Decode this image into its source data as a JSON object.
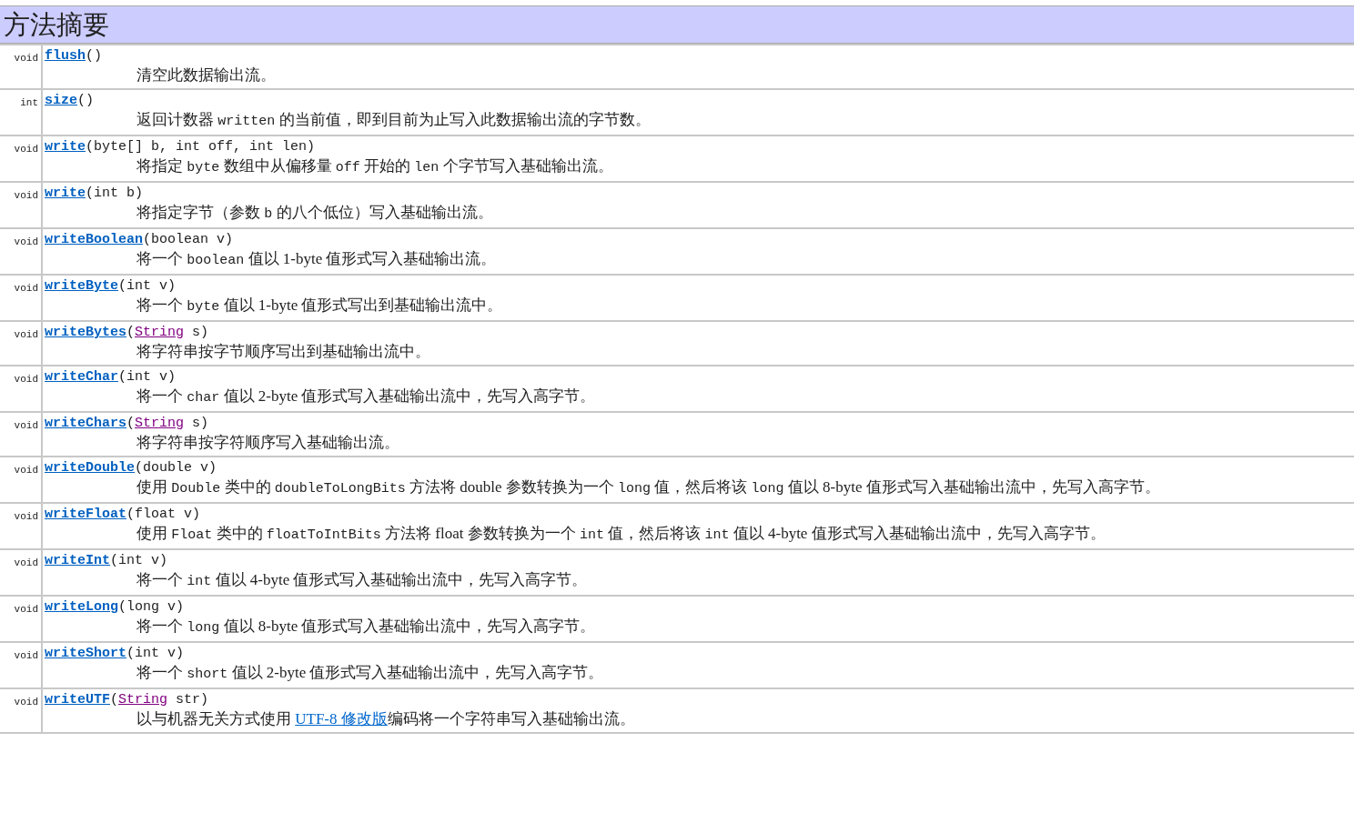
{
  "title": "方法摘要",
  "methods": [
    {
      "type": "void",
      "name": "flush",
      "params": [
        {
          "kind": "text",
          "text": "()"
        }
      ],
      "description": [
        {
          "kind": "text",
          "text": "清空此数据输出流。"
        }
      ]
    },
    {
      "type": "int",
      "name": "size",
      "params": [
        {
          "kind": "text",
          "text": "()"
        }
      ],
      "description": [
        {
          "kind": "text",
          "text": "返回计数器 "
        },
        {
          "kind": "code",
          "text": "written"
        },
        {
          "kind": "text",
          "text": " 的当前值，即到目前为止写入此数据输出流的字节数。"
        }
      ]
    },
    {
      "type": "void",
      "name": "write",
      "params": [
        {
          "kind": "text",
          "text": "(byte[] b, int off, int len)"
        }
      ],
      "description": [
        {
          "kind": "text",
          "text": "将指定 "
        },
        {
          "kind": "code",
          "text": "byte"
        },
        {
          "kind": "text",
          "text": " 数组中从偏移量 "
        },
        {
          "kind": "code",
          "text": "off"
        },
        {
          "kind": "text",
          "text": " 开始的 "
        },
        {
          "kind": "code",
          "text": "len"
        },
        {
          "kind": "text",
          "text": " 个字节写入基础输出流。"
        }
      ]
    },
    {
      "type": "void",
      "name": "write",
      "params": [
        {
          "kind": "text",
          "text": "(int b)"
        }
      ],
      "description": [
        {
          "kind": "text",
          "text": "将指定字节（参数 "
        },
        {
          "kind": "code",
          "text": "b"
        },
        {
          "kind": "text",
          "text": " 的八个低位）写入基础输出流。"
        }
      ]
    },
    {
      "type": "void",
      "name": "writeBoolean",
      "params": [
        {
          "kind": "text",
          "text": "(boolean v)"
        }
      ],
      "description": [
        {
          "kind": "text",
          "text": "将一个 "
        },
        {
          "kind": "code",
          "text": "boolean"
        },
        {
          "kind": "text",
          "text": " 值以 1-byte 值形式写入基础输出流。"
        }
      ]
    },
    {
      "type": "void",
      "name": "writeByte",
      "params": [
        {
          "kind": "text",
          "text": "(int v)"
        }
      ],
      "description": [
        {
          "kind": "text",
          "text": "将一个 "
        },
        {
          "kind": "code",
          "text": "byte"
        },
        {
          "kind": "text",
          "text": " 值以 1-byte 值形式写出到基础输出流中。"
        }
      ]
    },
    {
      "type": "void",
      "name": "writeBytes",
      "params": [
        {
          "kind": "text",
          "text": "("
        },
        {
          "kind": "link",
          "text": "String"
        },
        {
          "kind": "text",
          "text": " s)"
        }
      ],
      "description": [
        {
          "kind": "text",
          "text": "将字符串按字节顺序写出到基础输出流中。"
        }
      ]
    },
    {
      "type": "void",
      "name": "writeChar",
      "params": [
        {
          "kind": "text",
          "text": "(int v)"
        }
      ],
      "description": [
        {
          "kind": "text",
          "text": "将一个 "
        },
        {
          "kind": "code",
          "text": "char"
        },
        {
          "kind": "text",
          "text": " 值以 2-byte 值形式写入基础输出流中，先写入高字节。"
        }
      ]
    },
    {
      "type": "void",
      "name": "writeChars",
      "params": [
        {
          "kind": "text",
          "text": "("
        },
        {
          "kind": "link",
          "text": "String"
        },
        {
          "kind": "text",
          "text": " s)"
        }
      ],
      "description": [
        {
          "kind": "text",
          "text": "将字符串按字符顺序写入基础输出流。"
        }
      ]
    },
    {
      "type": "void",
      "name": "writeDouble",
      "params": [
        {
          "kind": "text",
          "text": "(double v)"
        }
      ],
      "description": [
        {
          "kind": "text",
          "text": "使用 "
        },
        {
          "kind": "code",
          "text": "Double"
        },
        {
          "kind": "text",
          "text": " 类中的 "
        },
        {
          "kind": "code",
          "text": "doubleToLongBits"
        },
        {
          "kind": "text",
          "text": " 方法将 double 参数转换为一个 "
        },
        {
          "kind": "code",
          "text": "long"
        },
        {
          "kind": "text",
          "text": " 值，然后将该 "
        },
        {
          "kind": "code",
          "text": "long"
        },
        {
          "kind": "text",
          "text": " 值以 8-byte 值形式写入基础输出流中，先写入高字节。"
        }
      ]
    },
    {
      "type": "void",
      "name": "writeFloat",
      "params": [
        {
          "kind": "text",
          "text": "(float v)"
        }
      ],
      "description": [
        {
          "kind": "text",
          "text": "使用 "
        },
        {
          "kind": "code",
          "text": "Float"
        },
        {
          "kind": "text",
          "text": " 类中的 "
        },
        {
          "kind": "code",
          "text": "floatToIntBits"
        },
        {
          "kind": "text",
          "text": " 方法将 float 参数转换为一个 "
        },
        {
          "kind": "code",
          "text": "int"
        },
        {
          "kind": "text",
          "text": " 值，然后将该 "
        },
        {
          "kind": "code",
          "text": "int"
        },
        {
          "kind": "text",
          "text": " 值以 4-byte 值形式写入基础输出流中，先写入高字节。"
        }
      ]
    },
    {
      "type": "void",
      "name": "writeInt",
      "params": [
        {
          "kind": "text",
          "text": "(int v)"
        }
      ],
      "description": [
        {
          "kind": "text",
          "text": "将一个 "
        },
        {
          "kind": "code",
          "text": "int"
        },
        {
          "kind": "text",
          "text": " 值以 4-byte 值形式写入基础输出流中，先写入高字节。"
        }
      ]
    },
    {
      "type": "void",
      "name": "writeLong",
      "params": [
        {
          "kind": "text",
          "text": "(long v)"
        }
      ],
      "description": [
        {
          "kind": "text",
          "text": "将一个 "
        },
        {
          "kind": "code",
          "text": "long"
        },
        {
          "kind": "text",
          "text": " 值以 8-byte 值形式写入基础输出流中，先写入高字节。"
        }
      ]
    },
    {
      "type": "void",
      "name": "writeShort",
      "params": [
        {
          "kind": "text",
          "text": "(int v)"
        }
      ],
      "description": [
        {
          "kind": "text",
          "text": "将一个 "
        },
        {
          "kind": "code",
          "text": "short"
        },
        {
          "kind": "text",
          "text": " 值以 2-byte 值形式写入基础输出流中，先写入高字节。"
        }
      ]
    },
    {
      "type": "void",
      "name": "writeUTF",
      "params": [
        {
          "kind": "text",
          "text": "("
        },
        {
          "kind": "link",
          "text": "String"
        },
        {
          "kind": "text",
          "text": " str)"
        }
      ],
      "description": [
        {
          "kind": "text",
          "text": "以与机器无关方式使用 "
        },
        {
          "kind": "link",
          "text": "UTF-8 修改版"
        },
        {
          "kind": "text",
          "text": "编码将一个字符串写入基础输出流。"
        }
      ]
    }
  ]
}
